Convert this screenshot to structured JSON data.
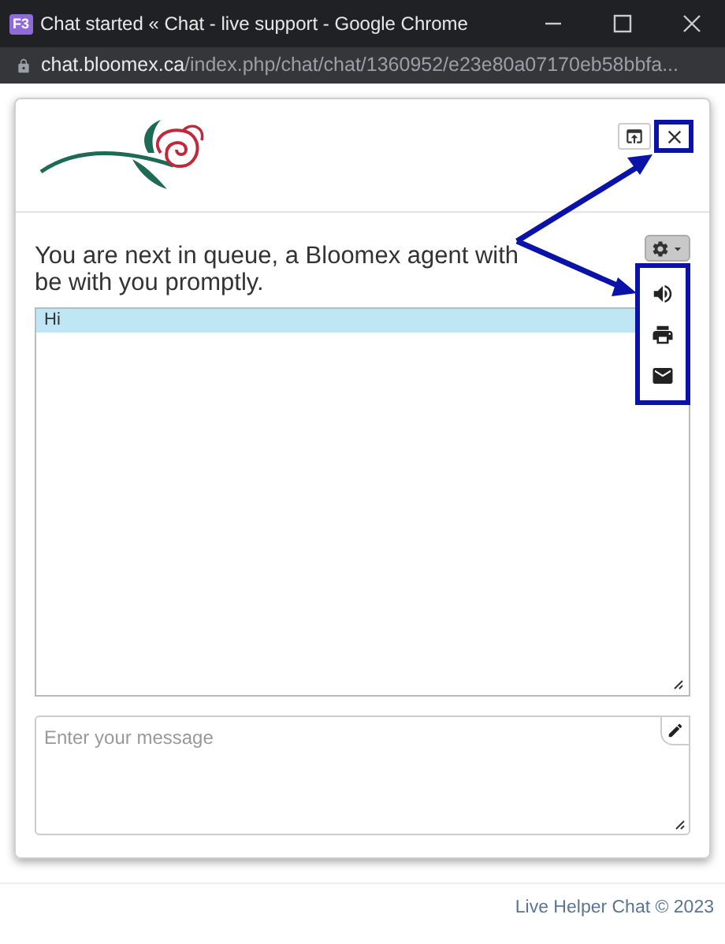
{
  "window": {
    "title": "Chat started « Chat - live support - Google Chrome",
    "app_badge": "F3"
  },
  "address_bar": {
    "domain": "chat.bloomex.ca",
    "path": "/index.php/chat/chat/1360952/e23e80a07170eb58bbfa..."
  },
  "chat": {
    "status_message": "You are next in queue, a Bloomex agent with be with you promptly.",
    "messages": [
      {
        "text": "Hi",
        "highlighted": true
      }
    ],
    "settings_menu": {
      "expanded": true
    },
    "input": {
      "placeholder": "Enter your message"
    }
  },
  "footer": {
    "text": "Live Helper Chat © 2023"
  }
}
